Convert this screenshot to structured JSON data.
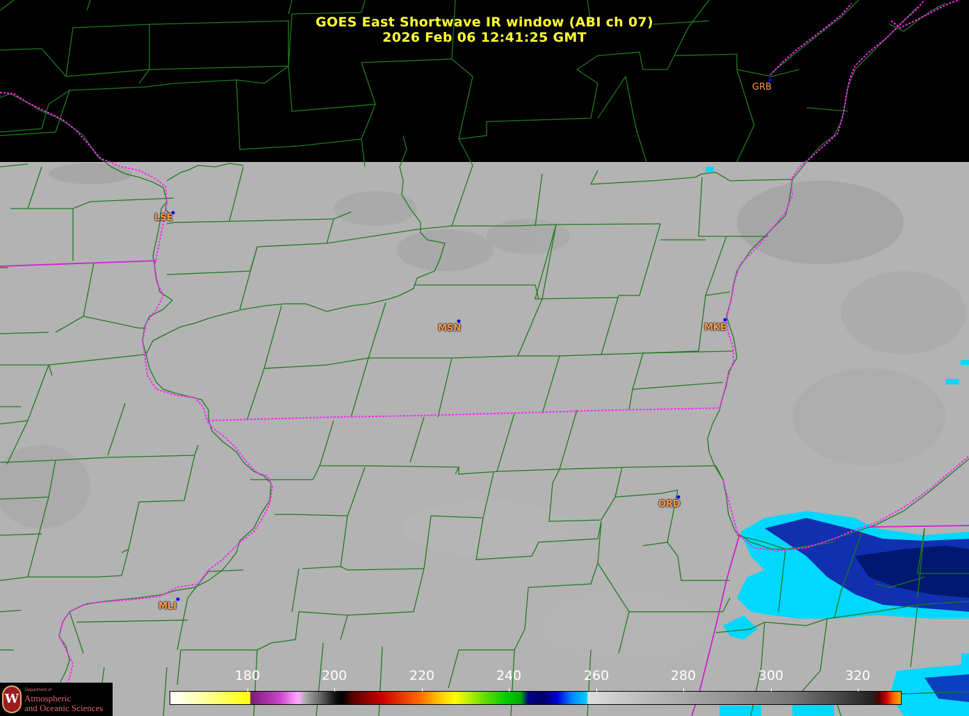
{
  "title": {
    "line1": "GOES East Shortwave IR window (ABI ch 07)",
    "line2": "2026 Feb 06  12:41:25 GMT"
  },
  "stations": [
    {
      "id": "GRB"
    },
    {
      "id": "LSE"
    },
    {
      "id": "MSN"
    },
    {
      "id": "MKE"
    },
    {
      "id": "ORD"
    },
    {
      "id": "MLI"
    }
  ],
  "colorbar": {
    "ticks": [
      "180",
      "200",
      "220",
      "240",
      "260",
      "280",
      "300",
      "320"
    ]
  },
  "logo": {
    "dept": "Department of",
    "line1": "Atmospheric",
    "line2": "and Oceanic Sciences",
    "seal_letter": "W"
  },
  "colors": {
    "title": "#ffff33",
    "county_lines": "#1f7a1f",
    "state_lines": "#ff33ff",
    "station_label": "#ff9a4a",
    "station_dot": "#0000ff",
    "cloud_free_gray": "#b4b4b4"
  }
}
